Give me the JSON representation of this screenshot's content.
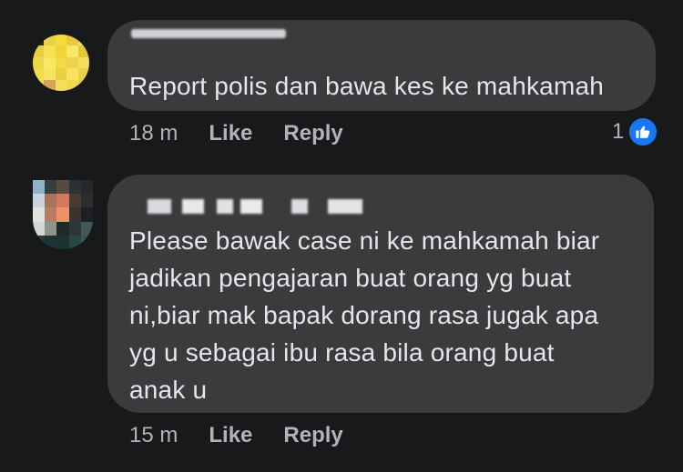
{
  "comments": [
    {
      "author": "",
      "text": "Report polis dan bawa kes ke mahkamah",
      "time": "18 m",
      "like_label": "Like",
      "reply_label": "Reply",
      "reaction_count": "1",
      "reaction_icon": "thumbs-up-icon"
    },
    {
      "author": "",
      "text_lines": [
        "Please bawak case ni ke mahkamah biar",
        "jadikan pengajaran buat orang yg buat",
        "ni,biar mak bapak dorang rasa jugak apa",
        "yg u sebagai ibu rasa bila orang buat",
        "anak u"
      ],
      "time": "15 m",
      "like_label": "Like",
      "reply_label": "Reply"
    }
  ],
  "colors": {
    "background": "#18191a",
    "bubble": "#3a3b3c",
    "text": "#e4e6eb",
    "meta": "#b0b3b8",
    "like_badge": "#1877f2"
  }
}
